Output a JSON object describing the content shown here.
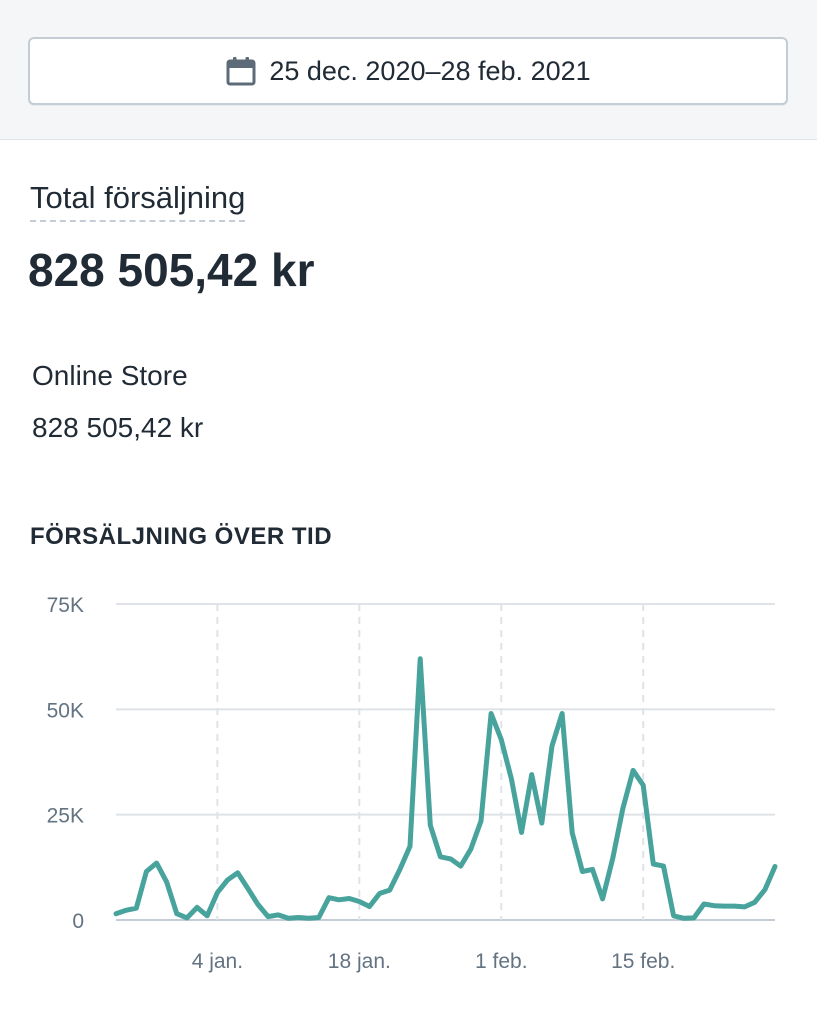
{
  "date_range": {
    "label": "25 dec. 2020–28 feb. 2021",
    "icon": "calendar-icon"
  },
  "summary": {
    "title": "Total försäljning",
    "value": "828 505,42 kr",
    "channel_name": "Online Store",
    "channel_value": "828 505,42 kr"
  },
  "chart_heading": "FÖRSÄLJNING ÖVER TID",
  "colors": {
    "line": "#47a39c",
    "grid": "#dfe3e8",
    "axis_text": "#637381"
  },
  "chart_data": {
    "type": "line",
    "title": "FÖRSÄLJNING ÖVER TID",
    "xlabel": "",
    "ylabel": "",
    "ylim": [
      0,
      75000
    ],
    "yticks": [
      0,
      25000,
      50000,
      75000
    ],
    "ytick_labels": [
      "0",
      "25K",
      "50K",
      "75K"
    ],
    "xtick_labels": [
      "4 jan.",
      "18 jan.",
      "1 feb.",
      "15 feb."
    ],
    "xtick_dates": [
      "2021-01-04",
      "2021-01-18",
      "2021-02-01",
      "2021-02-15"
    ],
    "x_range": [
      "2020-12-25",
      "2021-02-28"
    ],
    "grid": true,
    "series": [
      {
        "x": [
          "2020-12-25",
          "2020-12-26",
          "2020-12-27",
          "2020-12-28",
          "2020-12-29",
          "2020-12-30",
          "2020-12-31",
          "2021-01-01",
          "2021-01-02",
          "2021-01-03",
          "2021-01-04",
          "2021-01-05",
          "2021-01-06",
          "2021-01-07",
          "2021-01-08",
          "2021-01-09",
          "2021-01-10",
          "2021-01-11",
          "2021-01-12",
          "2021-01-13",
          "2021-01-14",
          "2021-01-15",
          "2021-01-16",
          "2021-01-17",
          "2021-01-18",
          "2021-01-19",
          "2021-01-20",
          "2021-01-21",
          "2021-01-22",
          "2021-01-23",
          "2021-01-24",
          "2021-01-25",
          "2021-01-26",
          "2021-01-27",
          "2021-01-28",
          "2021-01-29",
          "2021-01-30",
          "2021-01-31",
          "2021-02-01",
          "2021-02-02",
          "2021-02-03",
          "2021-02-04",
          "2021-02-05",
          "2021-02-06",
          "2021-02-07",
          "2021-02-08",
          "2021-02-09",
          "2021-02-10",
          "2021-02-11",
          "2021-02-12",
          "2021-02-13",
          "2021-02-14",
          "2021-02-15",
          "2021-02-16",
          "2021-02-17",
          "2021-02-18",
          "2021-02-19",
          "2021-02-20",
          "2021-02-21",
          "2021-02-22",
          "2021-02-23",
          "2021-02-24",
          "2021-02-25",
          "2021-02-26",
          "2021-02-27",
          "2021-02-28"
        ],
        "values": [
          1500,
          2300,
          2800,
          11500,
          13500,
          9000,
          1500,
          500,
          3000,
          1000,
          6500,
          9500,
          11200,
          7500,
          3700,
          800,
          1200,
          400,
          600,
          400,
          600,
          5300,
          4800,
          5100,
          4400,
          3200,
          6300,
          7100,
          12000,
          17500,
          62000,
          22500,
          15000,
          14500,
          12800,
          16800,
          23500,
          49000,
          42800,
          33500,
          20800,
          34500,
          23000,
          41300,
          49000,
          20700,
          11500,
          12000,
          5000,
          14700,
          26500,
          35500,
          32000,
          13300,
          12800,
          1000,
          400,
          500,
          3800,
          3400,
          3300,
          3300,
          3100,
          4200,
          7200,
          12700
        ]
      }
    ]
  }
}
